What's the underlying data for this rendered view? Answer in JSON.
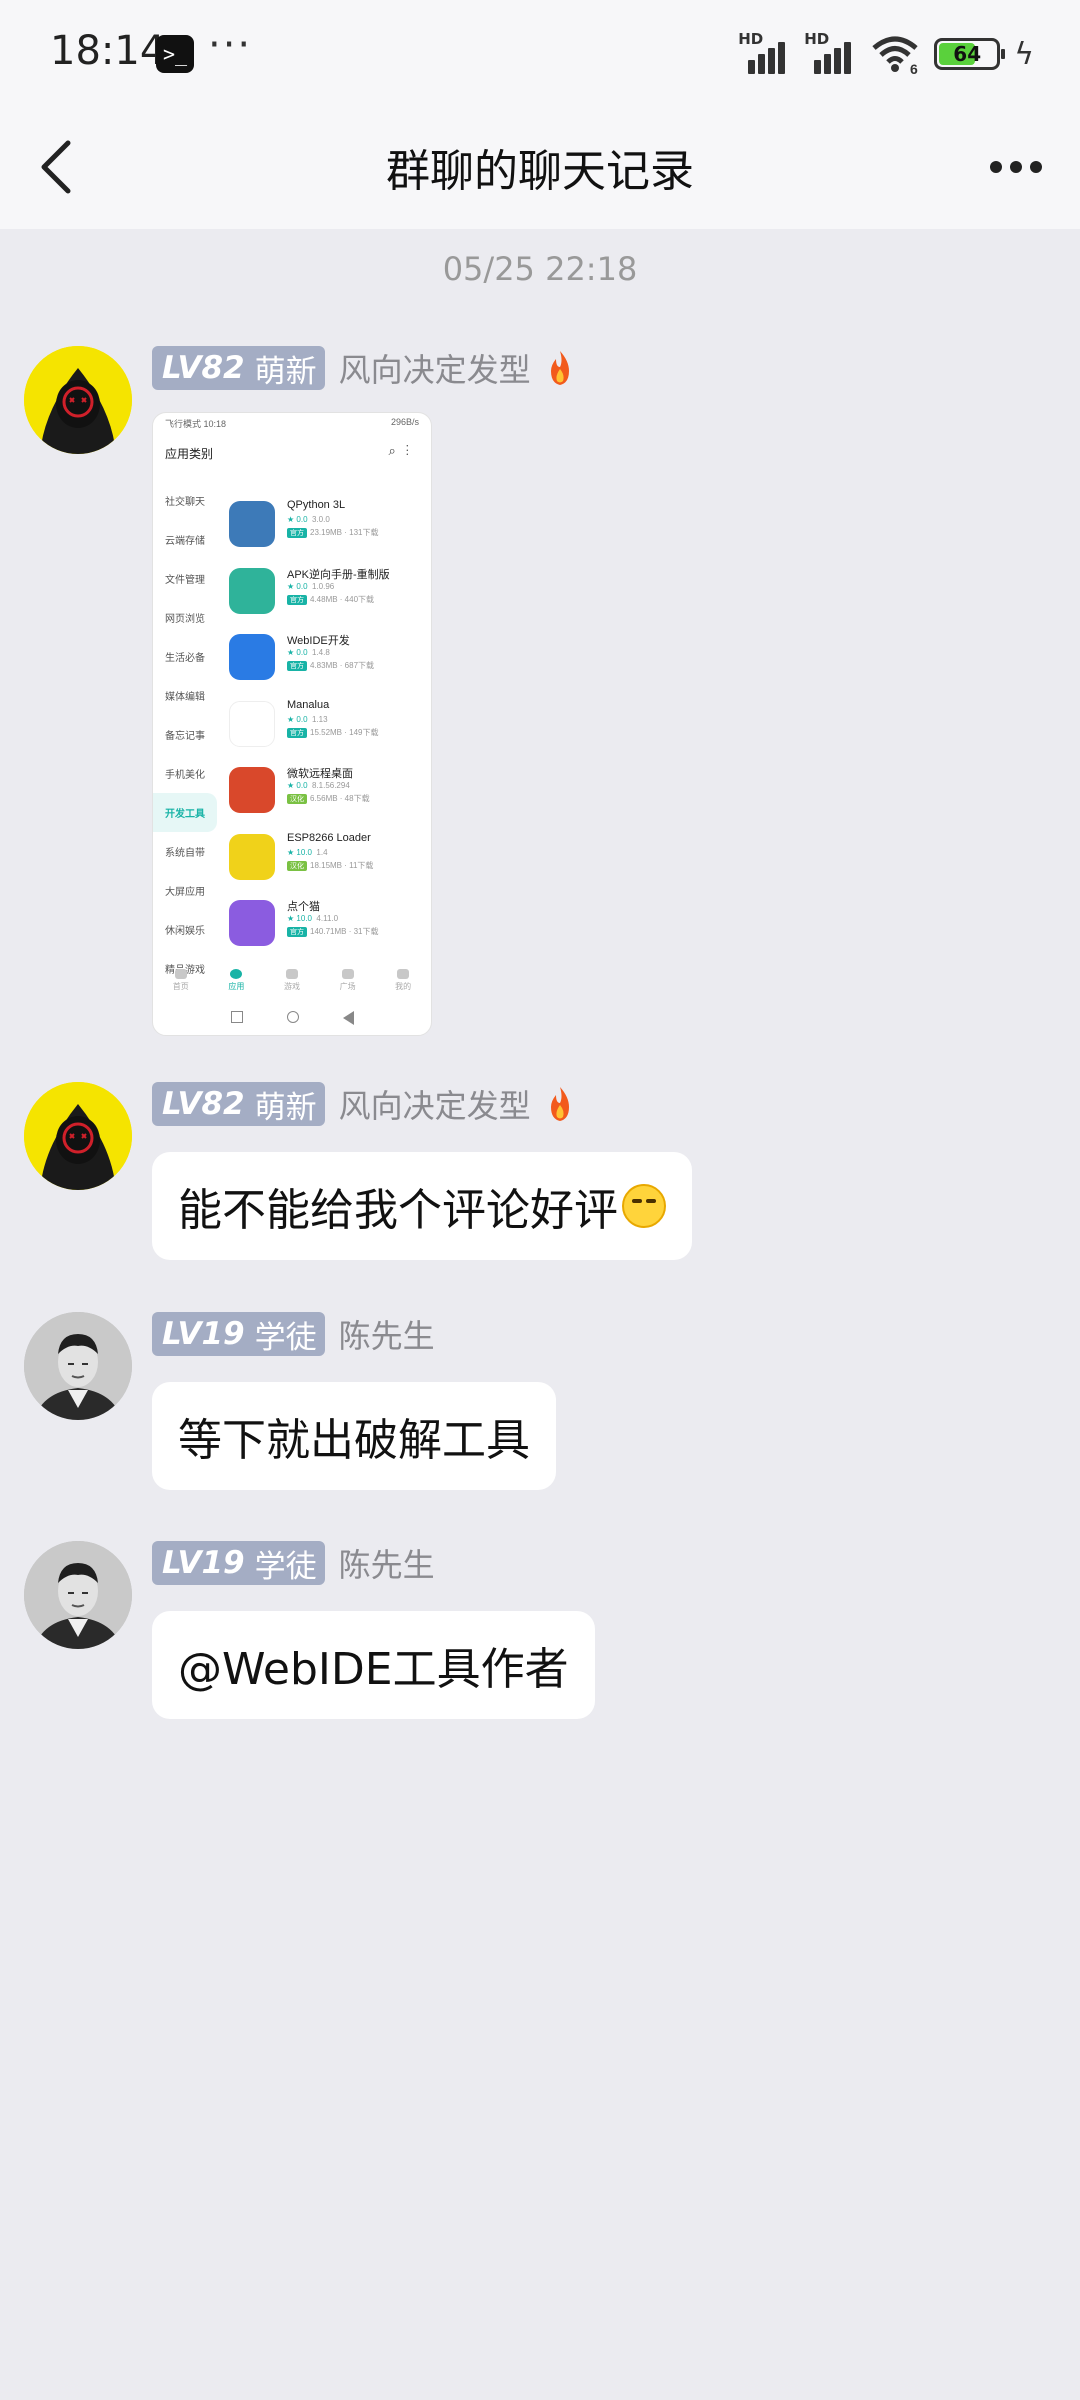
{
  "status_bar": {
    "time": "18:14",
    "terminal_glyph": ">_",
    "more": "···",
    "signal1_label": "HD",
    "signal2_label": "HD",
    "wifi_label": "6",
    "battery": "64"
  },
  "nav": {
    "back_icon": "chevron-left-icon",
    "title": "群聊的聊天记录",
    "more_icon": "more-dots-icon"
  },
  "timestamp": "05/25 22:18",
  "messages": [
    {
      "level": "LV82",
      "rank": "萌新",
      "name": "风向决定发型",
      "fire_icon": "fire-icon",
      "type": "image",
      "image": {
        "status_left": "飞行模式 10:18",
        "status_right": "296B/s",
        "header_title": "应用类别",
        "categories": [
          "社交聊天",
          "云端存储",
          "文件管理",
          "网页浏览",
          "生活必备",
          "媒体编辑",
          "备忘记事",
          "手机美化",
          "开发工具",
          "系统自带",
          "大屏应用",
          "休闲娱乐",
          "精品游戏"
        ],
        "active_category": "开发工具",
        "apps": [
          {
            "name": "QPython 3L",
            "rating": "★ 0.0",
            "version": "3.0.0",
            "tag": "官方",
            "size": "23.19MB · 131下载",
            "color": "#3d7ab8"
          },
          {
            "name": "APK逆向手册-重制版",
            "rating": "★ 0.0",
            "version": "1.0.96",
            "tag": "官方",
            "size": "4.48MB · 440下载",
            "color": "#2fb39a"
          },
          {
            "name": "WebIDE开发",
            "rating": "★ 0.0",
            "version": "1.4.8",
            "tag": "官方",
            "size": "4.83MB · 687下载",
            "color": "#2a7be4"
          },
          {
            "name": "Manalua",
            "rating": "★ 0.0",
            "version": "1.13",
            "tag": "官方",
            "size": "15.52MB · 149下载",
            "color": "#ffffff"
          },
          {
            "name": "微软远程桌面",
            "rating": "★ 0.0",
            "version": "8.1.56.294",
            "tag": "汉化",
            "size": "6.56MB · 48下载",
            "color": "#d9482b"
          },
          {
            "name": "ESP8266 Loader",
            "rating": "★ 10.0",
            "version": "1.4",
            "tag": "汉化",
            "size": "18.15MB · 11下载",
            "color": "#f0d21a"
          },
          {
            "name": "点个猫",
            "rating": "★ 10.0",
            "version": "4.11.0",
            "tag": "官方",
            "size": "140.71MB · 31下载",
            "color": "#8b5ce0"
          }
        ],
        "tabs": [
          "首页",
          "应用",
          "游戏",
          "广场",
          "我的"
        ],
        "active_tab": "应用"
      }
    },
    {
      "level": "LV82",
      "rank": "萌新",
      "name": "风向决定发型",
      "fire_icon": "fire-icon",
      "type": "text",
      "text": "能不能给我个评论好评",
      "emoji": "grin-emoji-icon"
    },
    {
      "level": "LV19",
      "rank": "学徒",
      "name": "陈先生",
      "type": "text",
      "text": "等下就出破解工具"
    },
    {
      "level": "LV19",
      "rank": "学徒",
      "name": "陈先生",
      "type": "text",
      "text": "@WebIDE工具作者"
    }
  ],
  "colors": {
    "background": "#ebebf0",
    "badge": "#a4adc4",
    "accent": "#18b3a6"
  }
}
